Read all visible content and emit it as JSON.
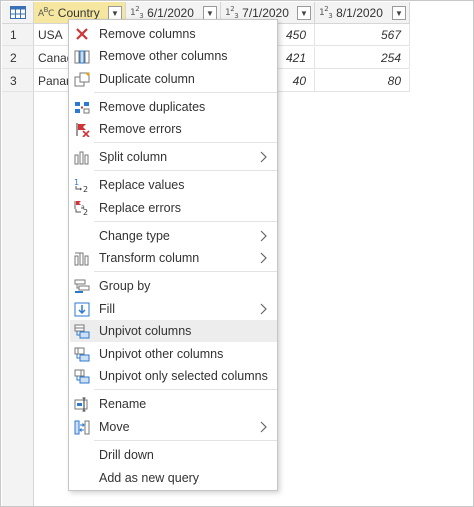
{
  "columns": [
    {
      "name": "Country",
      "type": "ABC"
    },
    {
      "name": "6/1/2020",
      "type": "123"
    },
    {
      "name": "7/1/2020",
      "type": "123"
    },
    {
      "name": "8/1/2020",
      "type": "123"
    }
  ],
  "row_numbers": [
    "1",
    "2",
    "3"
  ],
  "rows": [
    {
      "country": "USA",
      "c6": "",
      "c7": "450",
      "c8": "567"
    },
    {
      "country": "Canad",
      "c6": "",
      "c7": "421",
      "c8": "254"
    },
    {
      "country": "Panam",
      "c6": "",
      "c7": "40",
      "c8": "80"
    }
  ],
  "type_labels": {
    "text": "ABC",
    "number": "123"
  },
  "menu": {
    "items": [
      {
        "label": "Remove columns",
        "icon": "remove-columns-icon"
      },
      {
        "label": "Remove other columns",
        "icon": "remove-other-columns-icon"
      },
      {
        "label": "Duplicate column",
        "icon": "duplicate-column-icon"
      },
      {
        "label": "Remove duplicates",
        "icon": "remove-duplicates-icon"
      },
      {
        "label": "Remove errors",
        "icon": "remove-errors-icon"
      },
      {
        "label": "Split column",
        "icon": "split-column-icon",
        "submenu": true
      },
      {
        "label": "Replace values",
        "icon": "replace-values-icon"
      },
      {
        "label": "Replace errors",
        "icon": "replace-errors-icon"
      },
      {
        "label": "Change type",
        "icon": "",
        "submenu": true
      },
      {
        "label": "Transform column",
        "icon": "transform-column-icon",
        "submenu": true
      },
      {
        "label": "Group by",
        "icon": "group-by-icon"
      },
      {
        "label": "Fill",
        "icon": "fill-icon",
        "submenu": true
      },
      {
        "label": "Unpivot columns",
        "icon": "unpivot-columns-icon",
        "hover": true
      },
      {
        "label": "Unpivot other columns",
        "icon": "unpivot-other-columns-icon"
      },
      {
        "label": "Unpivot only selected columns",
        "icon": "unpivot-selected-columns-icon"
      },
      {
        "label": "Rename",
        "icon": "rename-icon"
      },
      {
        "label": "Move",
        "icon": "move-icon",
        "submenu": true
      },
      {
        "label": "Drill down",
        "icon": ""
      },
      {
        "label": "Add as new query",
        "icon": ""
      }
    ]
  },
  "colors": {
    "selected_header": "#f6e7a0",
    "menu_hover": "#ededed",
    "red_icon": "#d13438",
    "blue_icon": "#2b79d1"
  }
}
